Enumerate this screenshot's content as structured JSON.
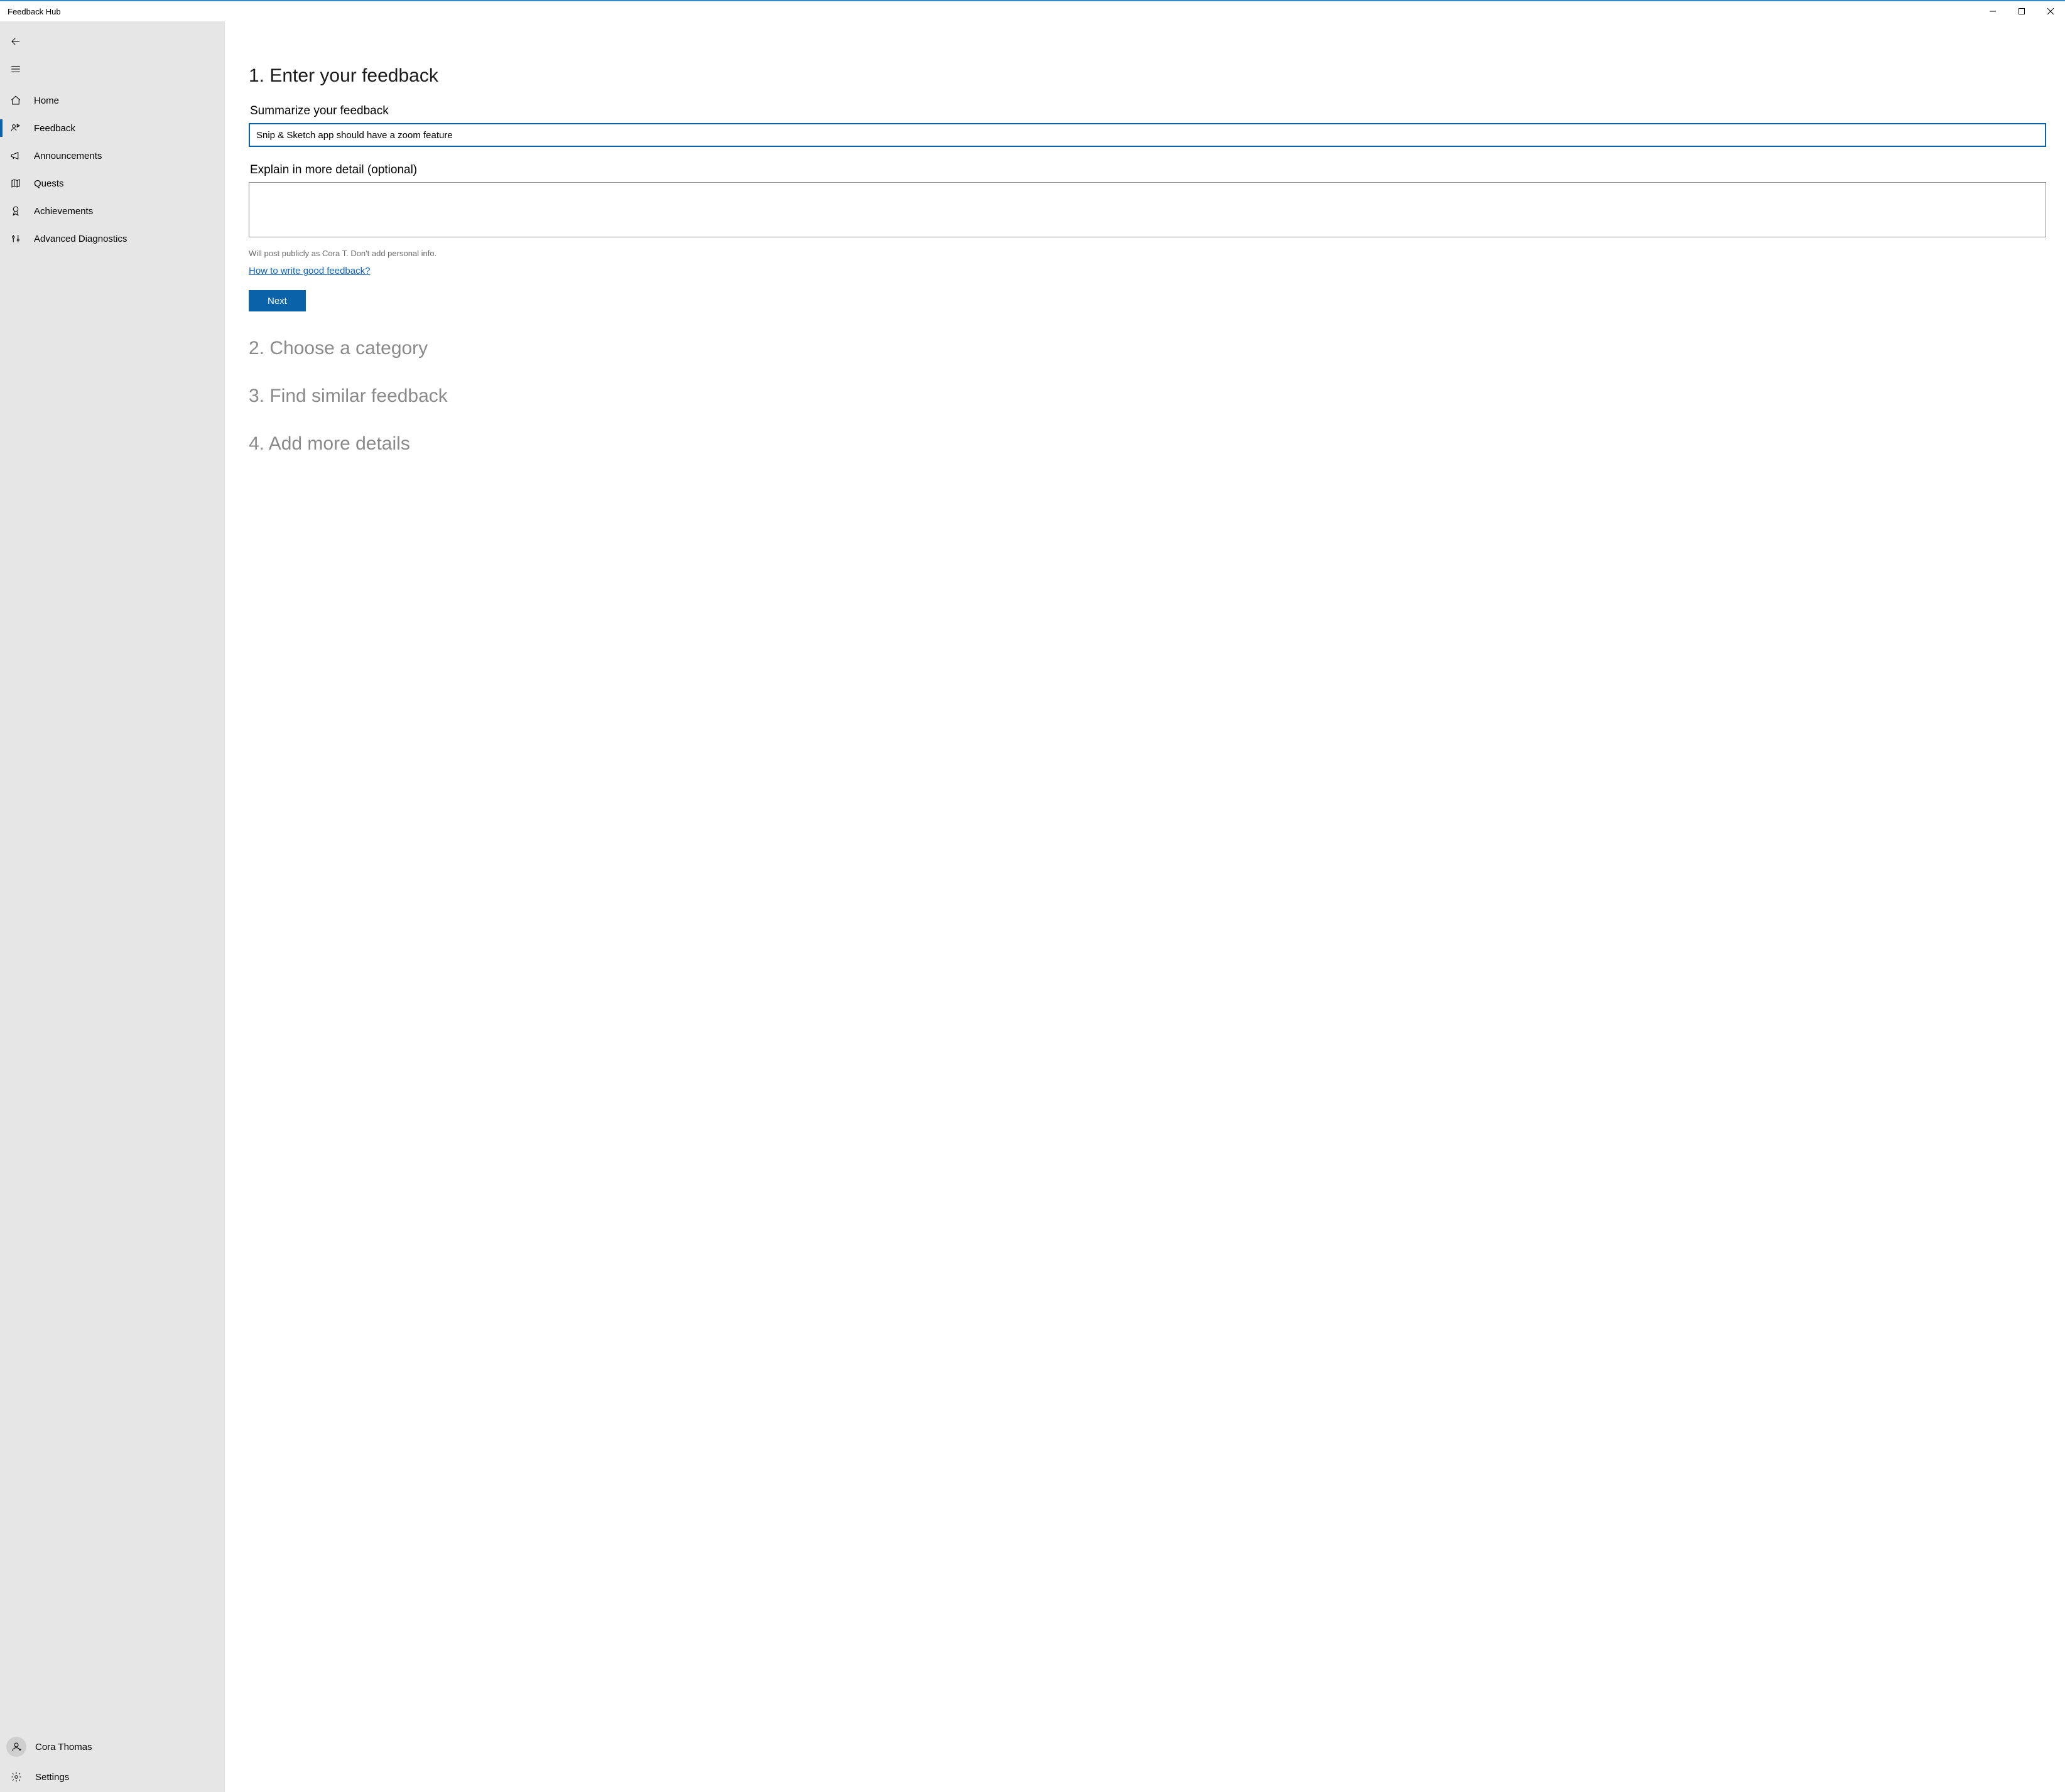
{
  "window": {
    "title": "Feedback Hub"
  },
  "sidebar": {
    "nav": [
      {
        "label": "Home"
      },
      {
        "label": "Feedback"
      },
      {
        "label": "Announcements"
      },
      {
        "label": "Quests"
      },
      {
        "label": "Achievements"
      },
      {
        "label": "Advanced Diagnostics"
      }
    ],
    "user": {
      "name": "Cora Thomas"
    },
    "settings_label": "Settings"
  },
  "main": {
    "step1": {
      "title": "1. Enter your feedback",
      "summary_label": "Summarize your feedback",
      "summary_value": "Snip & Sketch app should have a zoom feature",
      "detail_label": "Explain in more detail (optional)",
      "detail_value": "",
      "publish_note": "Will post publicly as Cora T. Don't add personal info.",
      "write_link": "How to write good feedback?",
      "next_label": "Next"
    },
    "step2_title": "2. Choose a category",
    "step3_title": "3. Find similar feedback",
    "step4_title": "4. Add more details"
  }
}
